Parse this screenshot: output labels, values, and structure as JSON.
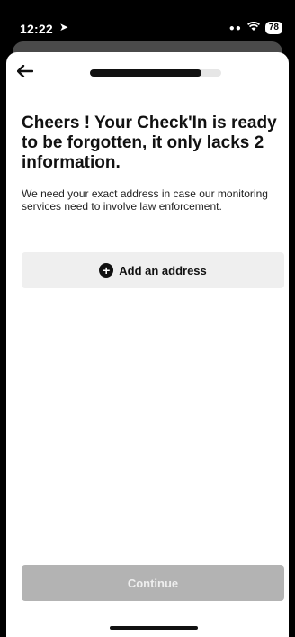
{
  "status_bar": {
    "time": "12:22",
    "location_icon": "location-arrow-icon",
    "signal_icon": "signal-dots-icon",
    "wifi_icon": "wifi-icon",
    "battery": "78"
  },
  "header": {
    "back_icon": "arrow-left-icon",
    "progress": 0.85
  },
  "content": {
    "title": "Cheers ! Your Check'In is ready to be forgotten, it only lacks 2 information.",
    "subtitle": "We need your exact address in case our monitoring services need to involve law enforcement."
  },
  "add_address": {
    "label": "Add an address",
    "icon": "plus-circle-icon"
  },
  "footer": {
    "continue_label": "Continue",
    "continue_disabled": true
  },
  "colors": {
    "accent": "#111111",
    "button_bg": "#efefef",
    "disabled_bg": "#b3b3b3"
  }
}
